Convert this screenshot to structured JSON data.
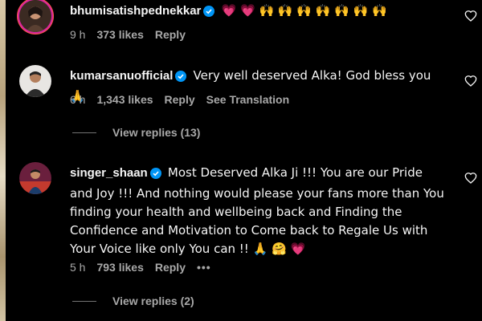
{
  "comments": [
    {
      "username": "bhumisatishpednekkar",
      "text": "💗 💗 🙌 🙌 🙌 🙌 🙌 🙌 🙌",
      "time": "9 h",
      "likes": "373 likes",
      "reply": "Reply"
    },
    {
      "username": "kumarsanuofficial",
      "text": "Very well deserved Alka! God bless you 🙏",
      "time": "6 h",
      "likes": "1,343 likes",
      "reply": "Reply",
      "translation": "See Translation",
      "view_replies": "View replies (13)"
    },
    {
      "username": "singer_shaan",
      "text": "Most Deserved Alka Ji !!! You are our Pride and Joy !!! And nothing would please your fans more than You finding your health and wellbeing back and Finding the Confidence and Motivation to Come back to Regale Us with Your Voice like only You can !! 🙏 🤗 💗",
      "time": "5 h",
      "likes": "793 likes",
      "reply": "Reply",
      "more": "•••",
      "view_replies": "View replies (2)"
    }
  ],
  "icons": {
    "verified": "verified-badge-icon",
    "like": "heart-outline-icon"
  },
  "colors": {
    "verified_blue": "#0095f6",
    "secondary_text": "#a8a8a8"
  }
}
